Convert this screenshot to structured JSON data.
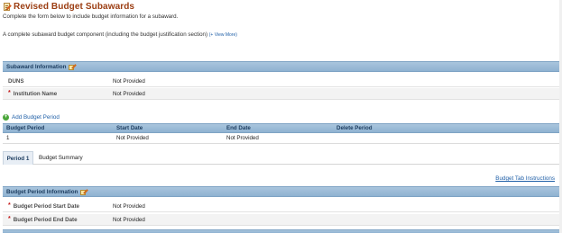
{
  "header": {
    "title": "Revised Budget Subawards",
    "intro": "Complete the form below to include budget information for a subaward.",
    "component_text": "A complete subaward budget component (including the budget justification section)",
    "view_more": "(+ View More)"
  },
  "subaward_section": {
    "title": "Subaward Information",
    "rows": [
      {
        "label": "DUNS",
        "value": "Not Provided",
        "required": false
      },
      {
        "label": "Institution Name",
        "value": "Not Provided",
        "required": true
      }
    ]
  },
  "budget_periods": {
    "add_label": "Add Budget Period",
    "columns": [
      "Budget Period",
      "Start Date",
      "End Date",
      "Delete Period"
    ],
    "rows": [
      {
        "period": "1",
        "start": "Not Provided",
        "end": "Not Provided",
        "delete": ""
      }
    ]
  },
  "tabs": [
    "Period 1",
    "Budget Summary"
  ],
  "instructions_link": "Budget Tab Instructions",
  "period_section": {
    "title": "Budget Period Information",
    "rows": [
      {
        "label": "Budget Period Start Date",
        "value": "Not Provided",
        "required": true
      },
      {
        "label": "Budget Period End Date",
        "value": "Not Provided",
        "required": true
      }
    ]
  },
  "icons": {
    "title": "budget-edit-icon",
    "section_edit": "pencil-edit-icon",
    "add": "plus-circle-icon",
    "required": "asterisk"
  },
  "colors": {
    "title": "#9b3d12",
    "link": "#1f5fa7",
    "header_band": "#a9c5dd",
    "required": "#c41a1a"
  }
}
